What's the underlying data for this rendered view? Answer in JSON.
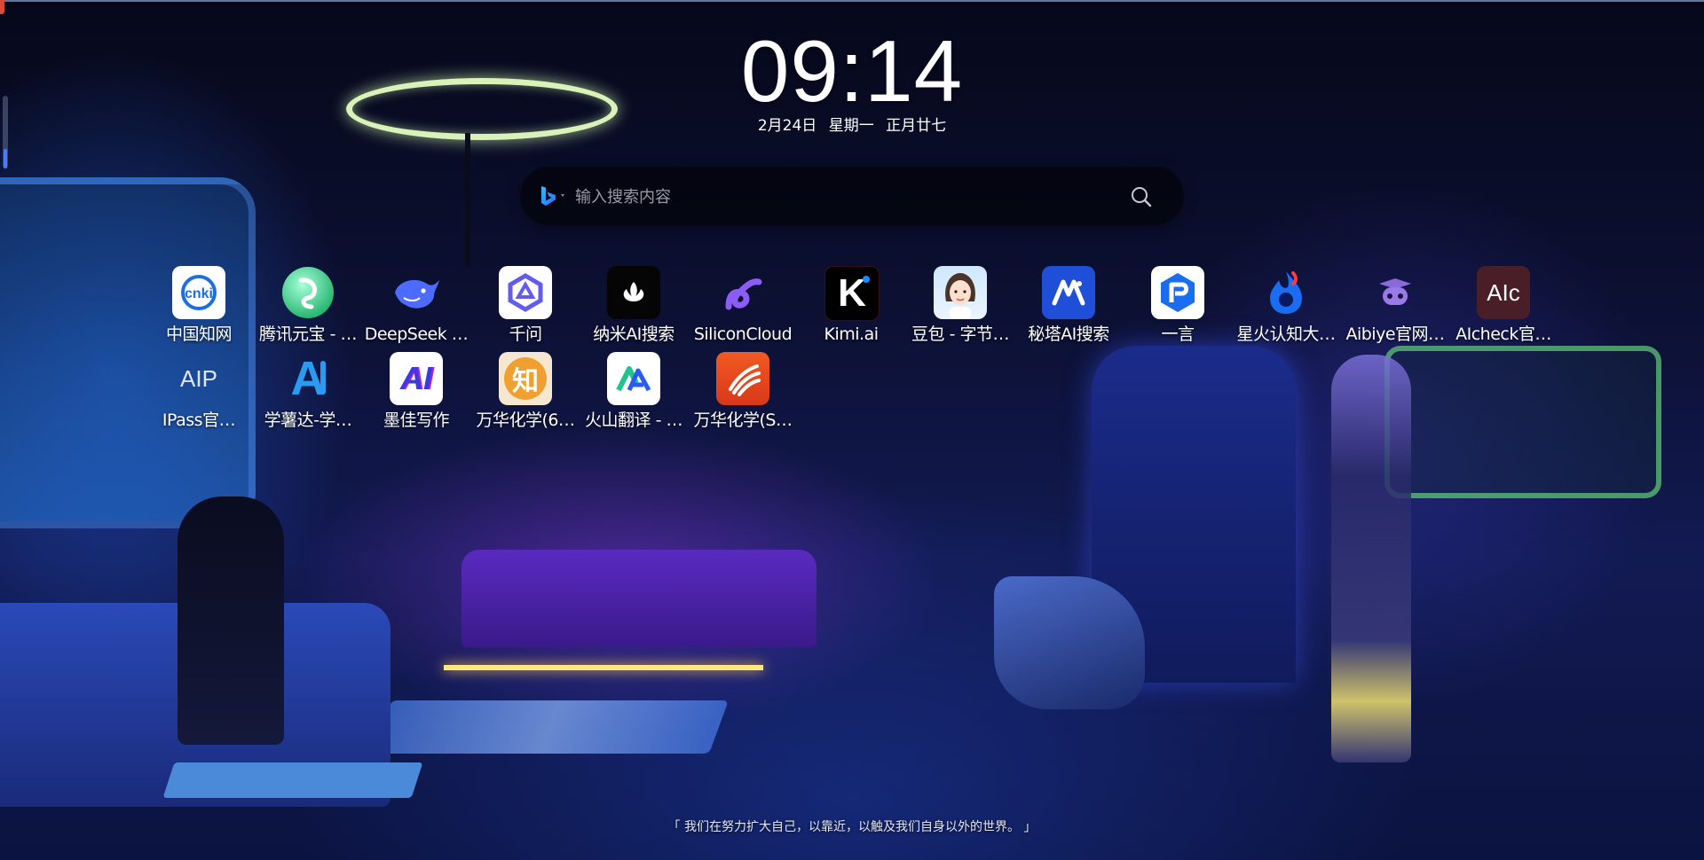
{
  "clock": {
    "time": "09:14",
    "date": "2月24日",
    "weekday": "星期一",
    "lunar": "正月廿七"
  },
  "search": {
    "placeholder": "输入搜索内容",
    "engine_icon": "bing-icon",
    "button_icon": "search-icon"
  },
  "shortcuts": [
    {
      "label": "中国知网",
      "icon": "cnki-icon"
    },
    {
      "label": "腾讯元宝 - …",
      "icon": "yuanbao-icon"
    },
    {
      "label": "DeepSeek …",
      "icon": "deepseek-whale-icon"
    },
    {
      "label": "千问",
      "icon": "qianwen-icon"
    },
    {
      "label": "纳米AI搜索",
      "icon": "nami-peacock-icon"
    },
    {
      "label": "SiliconCloud",
      "icon": "siliconcloud-icon"
    },
    {
      "label": "Kimi.ai",
      "icon": "kimi-icon",
      "icon_text": "K"
    },
    {
      "label": "豆包 - 字节…",
      "icon": "doubao-avatar-icon"
    },
    {
      "label": "秘塔AI搜索",
      "icon": "metaso-icon"
    },
    {
      "label": "一言",
      "icon": "yiyan-icon"
    },
    {
      "label": "星火认知大…",
      "icon": "xinghuo-flame-icon"
    },
    {
      "label": "Aibiye官网…",
      "icon": "aibiye-robot-icon"
    },
    {
      "label": "AIcheck官…",
      "icon": "aicheck-icon",
      "icon_text": "AIc"
    },
    {
      "label": "IPass官…",
      "icon": "aipass-icon",
      "icon_text": "AIP"
    },
    {
      "label": "学薯达-学…",
      "icon": "xueshuda-icon",
      "icon_text": "A"
    },
    {
      "label": "墨佳写作",
      "icon": "mojia-icon",
      "icon_text": "AI"
    },
    {
      "label": "万华化学(6…",
      "icon": "zhi-icon",
      "icon_text": "知"
    },
    {
      "label": "火山翻译 - …",
      "icon": "volcano-translate-icon",
      "icon_text": "A"
    },
    {
      "label": "万华化学(S…",
      "icon": "wanhua-icon"
    }
  ],
  "quote": "「 我们在努力扩大自己，以靠近，以触及我们自身以外的世界。 」",
  "colors": {
    "search_bg": "#04050e",
    "kimi_bg": "#000000",
    "metaso_bg": "#1f4fd8",
    "yiyan_bg": "#1a6cf0",
    "aicheck_bg": "#4a1e26",
    "wanhua_bg": "#e8441c",
    "zhi_bg": "#f0a030"
  }
}
